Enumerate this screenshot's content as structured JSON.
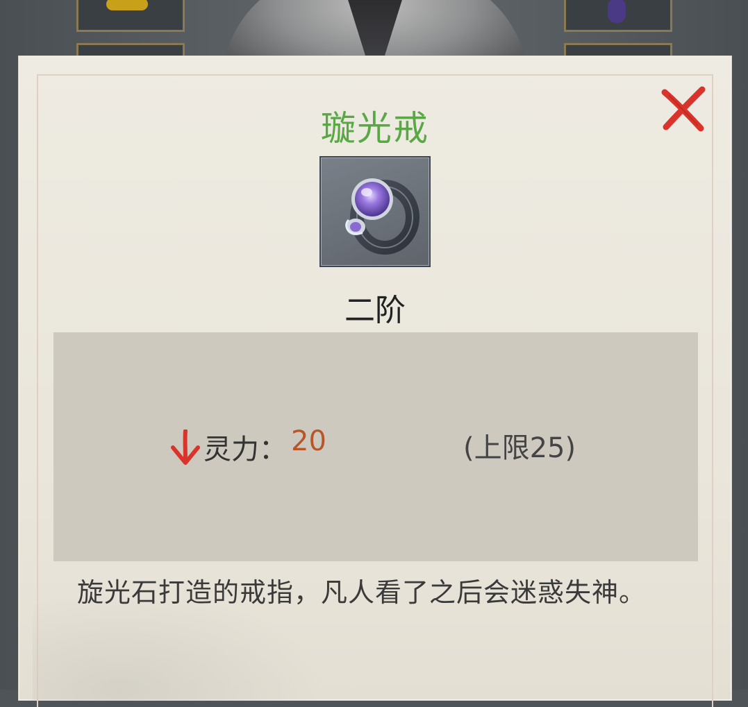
{
  "item": {
    "name": "璇光戒",
    "grade": "二阶",
    "description": "旋光石打造的戒指，凡人看了之后会迷惑失神。"
  },
  "stats": {
    "label": "灵力：",
    "value": "20",
    "limit": "(上限25)",
    "trend": "down"
  },
  "colors": {
    "title_green": "#5aa845",
    "value_orange": "#b8562a",
    "close_red": "#d9342b",
    "arrow_red": "#d9342b",
    "panel_bg": "#eeebe2",
    "stat_box_bg": "#cdc9bf"
  },
  "icons": {
    "close": "close-x-icon",
    "trend": "down-arrow-icon",
    "item": "ring-icon"
  }
}
